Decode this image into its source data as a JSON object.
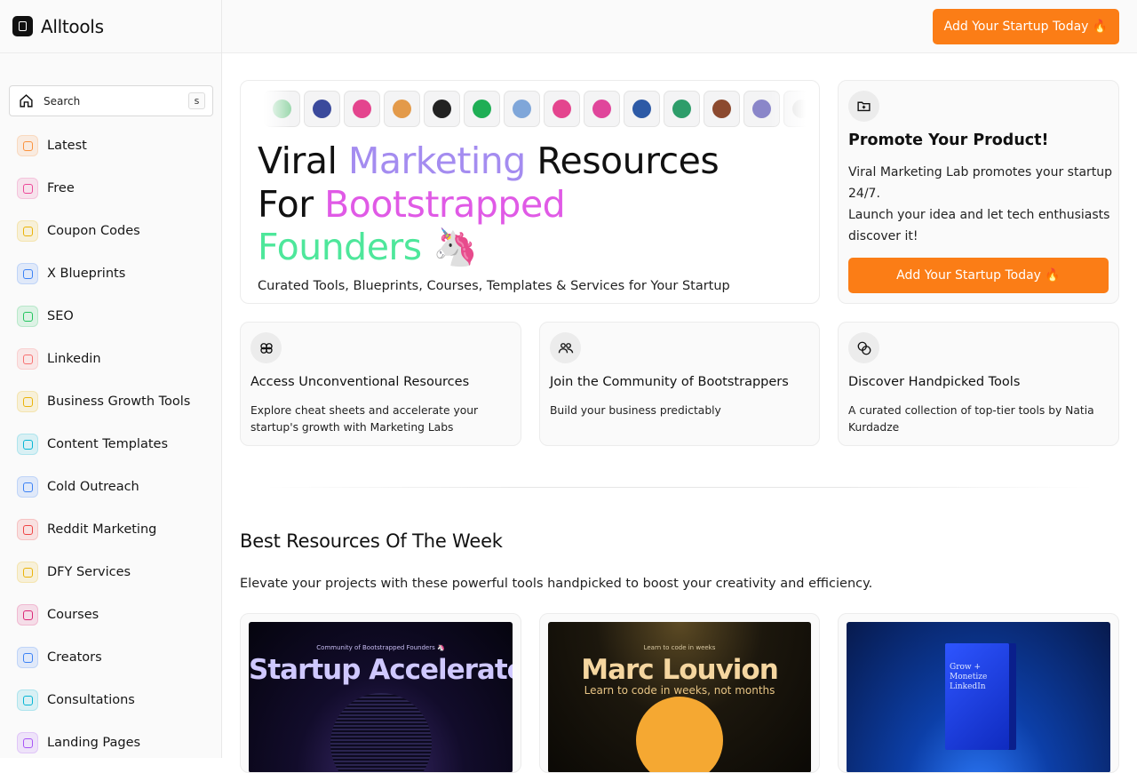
{
  "brand": {
    "name": "Alltools"
  },
  "topbar": {
    "cta_label": "Add Your Startup Today 🔥"
  },
  "sidebar": {
    "search_label": "Search",
    "search_shortcut": "s",
    "items": [
      {
        "label": "Latest",
        "icon": "grid-icon",
        "color": "#fb923c"
      },
      {
        "label": "Free",
        "icon": "wallet-icon",
        "color": "#ec4899"
      },
      {
        "label": "Coupon Codes",
        "icon": "ticket-icon",
        "color": "#eab308"
      },
      {
        "label": "X Blueprints",
        "icon": "feather-icon",
        "color": "#3b82f6"
      },
      {
        "label": "SEO",
        "icon": "tree-icon",
        "color": "#22c55e"
      },
      {
        "label": "Linkedin",
        "icon": "pen-icon",
        "color": "#f87171"
      },
      {
        "label": "Business Growth Tools",
        "icon": "bell-icon",
        "color": "#eab308"
      },
      {
        "label": "Content Templates",
        "icon": "pencil-icon",
        "color": "#06b6d4"
      },
      {
        "label": "Cold Outreach",
        "icon": "monitor-icon",
        "color": "#3b82f6"
      },
      {
        "label": "Reddit Marketing",
        "icon": "reddit-icon",
        "color": "#ef4444"
      },
      {
        "label": "DFY Services",
        "icon": "bike-icon",
        "color": "#eab308"
      },
      {
        "label": "Courses",
        "icon": "database-icon",
        "color": "#db2777"
      },
      {
        "label": "Creators",
        "icon": "star-icon",
        "color": "#3b82f6"
      },
      {
        "label": "Consultations",
        "icon": "phone-icon",
        "color": "#06b6d4"
      },
      {
        "label": "Landing Pages",
        "icon": "layout-icon",
        "color": "#a855f7"
      }
    ]
  },
  "hero": {
    "line1_a": "Viral ",
    "line1_b": "Marketing",
    "line1_c": " Resources",
    "line2_a": "For ",
    "line2_b": "Bootstrapped",
    "line3_a": "Founders",
    "line3_b": " 🦄",
    "subtitle": "Curated Tools, Blueprints, Courses, Templates & Services for Your Startup",
    "avatar_colors": [
      "#9fd9b0",
      "#3b4a9c",
      "#e4458e",
      "#e39a4a",
      "#222222",
      "#1fae55",
      "#7fa6d9",
      "#e4458e",
      "#e0469b",
      "#2d5aa6",
      "#2e9d6a",
      "#8c4a2f",
      "#8a86c9",
      "#cccccc"
    ]
  },
  "promo": {
    "title": "Promote Your Product!",
    "text": "Viral Marketing Lab promotes your startup 24/7.",
    "text2": "Launch your idea and let tech enthusiasts discover it!",
    "button": "Add Your Startup Today 🔥"
  },
  "features": [
    {
      "title": "Access Unconventional Resources",
      "text": "Explore cheat sheets and accelerate your startup's growth with Marketing Labs",
      "icon": "brain-icon"
    },
    {
      "title": "Join the Community of Bootstrappers",
      "text": "Build your business predictably",
      "icon": "users-icon"
    },
    {
      "title": "Discover Handpicked Tools",
      "text": "A curated collection of top-tier tools by Natia Kurdadze",
      "icon": "circles-icon"
    }
  ],
  "section": {
    "title": "Best Resources Of The Week",
    "subtitle": "Elevate your projects with these powerful tools handpicked to boost your creativity and efficiency."
  },
  "cards": [
    {
      "top": "Community of Bootstrapped Founders 🦄",
      "title": "Startup Accelerator"
    },
    {
      "top": "Learn to code in weeks",
      "title": "Marc Louvion",
      "sub": "Learn to code in weeks, not months"
    },
    {
      "title": "Grow + Monetize LinkedIn"
    }
  ]
}
